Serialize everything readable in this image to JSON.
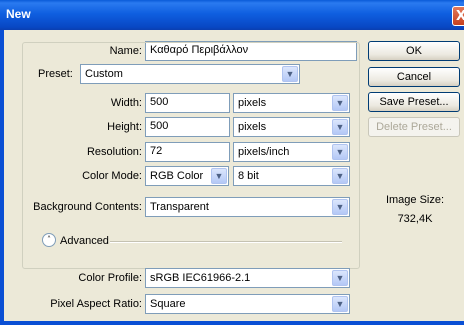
{
  "window": {
    "title": "New",
    "close_glyph": "X"
  },
  "form": {
    "name_label": "Name:",
    "name_value": "Καθαρό Περιβάλλον",
    "preset_label": "Preset:",
    "preset_value": "Custom",
    "width_label": "Width:",
    "width_value": "500",
    "width_unit": "pixels",
    "height_label": "Height:",
    "height_value": "500",
    "height_unit": "pixels",
    "resolution_label": "Resolution:",
    "resolution_value": "72",
    "resolution_unit": "pixels/inch",
    "color_mode_label": "Color Mode:",
    "color_mode_value": "RGB Color",
    "bit_depth_value": "8 bit",
    "background_label": "Background Contents:",
    "background_value": "Transparent",
    "advanced_label": "Advanced",
    "color_profile_label": "Color Profile:",
    "color_profile_value": "sRGB IEC61966-2.1",
    "pixel_aspect_label": "Pixel Aspect Ratio:",
    "pixel_aspect_value": "Square"
  },
  "buttons": {
    "ok": "OK",
    "cancel": "Cancel",
    "save_preset": "Save Preset...",
    "delete_preset": "Delete Preset..."
  },
  "info": {
    "image_size_label": "Image Size:",
    "image_size_value": "732,4K"
  },
  "icons": {
    "dropdown": "chevron-down-icon",
    "advanced": "chevron-up-double-icon"
  },
  "colors": {
    "titlebar": "#0a5bd8",
    "dialog_bg": "#ece9d8",
    "field_border": "#7f9db9"
  }
}
